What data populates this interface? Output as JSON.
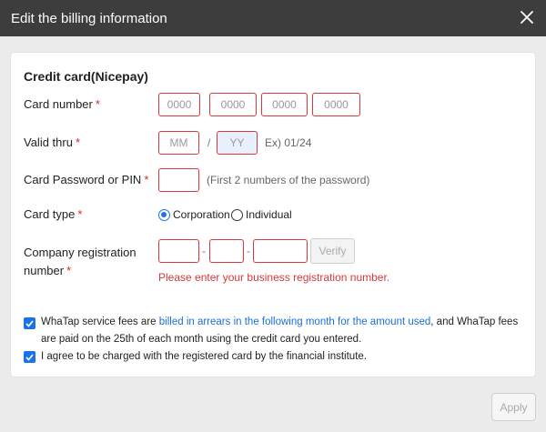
{
  "dialog": {
    "title": "Edit the billing information",
    "apply_label": "Apply"
  },
  "form": {
    "section_title": "Credit card(Nicepay)",
    "required_mark": "*",
    "card_number": {
      "label": "Card number",
      "placeholders": [
        "0000",
        "0000",
        "0000",
        "0000"
      ]
    },
    "valid_thru": {
      "label": "Valid thru",
      "month_placeholder": "MM",
      "separator": "/",
      "year_placeholder": "YY",
      "example": "Ex) 01/24"
    },
    "password": {
      "label": "Card Password or PIN",
      "hint": "(First 2 numbers of the password)"
    },
    "card_type": {
      "label": "Card type",
      "options": [
        "Corporation",
        "Individual"
      ],
      "selected": "Corporation"
    },
    "company_reg": {
      "label_line1": "Company registration",
      "label_line2": "number",
      "separator": "-",
      "verify_label": "Verify",
      "error": "Please enter your business registration number."
    },
    "consents": {
      "fees_prefix": "WhaTap service fees are ",
      "fees_link": "billed in arrears in the following month for the amount used",
      "fees_suffix_line1": ", and WhaTap fees",
      "fees_line2": "are paid on the 25th of each month using the credit card you entered.",
      "agree": "I agree to be charged with the registered card by the financial institute.",
      "fees_checked": true,
      "agree_checked": true
    }
  },
  "colors": {
    "header_bg": "#3d3d3d",
    "required": "#e02424",
    "input_border_error": "#d9383a",
    "accent": "#1a73e8",
    "link": "#1a6fd8"
  }
}
